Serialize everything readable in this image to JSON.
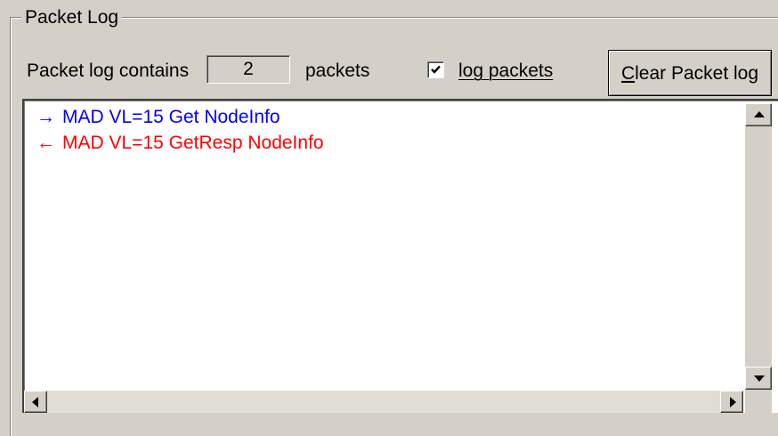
{
  "group": {
    "title": "Packet Log"
  },
  "summary": {
    "prefix": "Packet log contains",
    "count": "2",
    "suffix": "packets"
  },
  "log_checkbox": {
    "label": "log packets",
    "checked": true
  },
  "clear_button": {
    "accel": "C",
    "rest": "lear Packet log"
  },
  "entries": [
    {
      "arrow": "→",
      "text": "MAD VL=15 Get NodeInfo",
      "direction": "outgoing",
      "color": "#0000ff"
    },
    {
      "arrow": "←",
      "text": "MAD VL=15 GetResp NodeInfo",
      "direction": "incoming",
      "color": "#ff0000"
    }
  ],
  "colors": {
    "outgoing": "#0000ff",
    "incoming": "#ff0000",
    "face": "#d4d0c8"
  },
  "icons": {
    "scroll_up": "triangle-up-icon",
    "scroll_down": "triangle-down-icon",
    "scroll_left": "triangle-left-icon",
    "scroll_right": "triangle-right-icon",
    "check": "checkmark-icon"
  }
}
